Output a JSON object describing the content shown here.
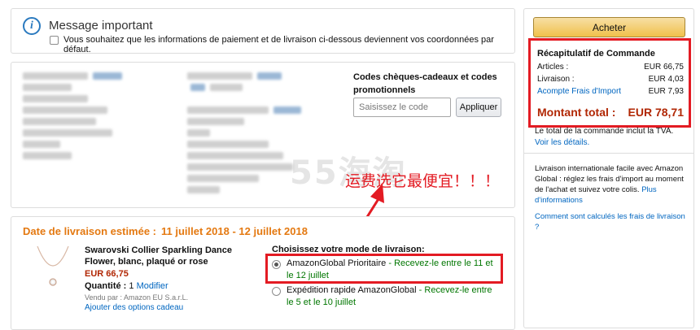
{
  "message": {
    "icon": "info-icon",
    "title": "Message important",
    "checkbox_label": "Vous souhaitez que les informations de paiement et de livraison ci-dessous deviennent vos coordonnées par défaut."
  },
  "codes": {
    "title": "Codes chèques-cadeaux et codes promotionnels",
    "placeholder": "Saisissez le code",
    "apply_label": "Appliquer"
  },
  "watermark": "55海淘",
  "annotation": "运费选它最便宜！！！",
  "delivery": {
    "label": "Date de livraison estimée :",
    "dates": "11 juillet 2018 - 12 juillet 2018",
    "product": {
      "name": "Swarovski Collier Sparkling Dance Flower, blanc, plaqué or rose",
      "price": "EUR 66,75",
      "quantity_label": "Quantité :",
      "quantity": "1",
      "modify_label": "Modifier",
      "seller": "Vendu par : Amazon EU S.a.r.L.",
      "gift_link": "Ajouter des options cadeau"
    },
    "shipping_title": "Choisissez votre mode de livraison:",
    "options": [
      {
        "name": "AmazonGlobal Prioritaire",
        "sep": " - ",
        "eta": "Recevez-le entre le 11 et le 12 juillet",
        "selected": true
      },
      {
        "name": "Expédition rapide AmazonGlobal",
        "sep": " - ",
        "eta": "Recevez-le entre le 5 et le 10 juillet",
        "selected": false
      }
    ]
  },
  "summary": {
    "buy_label": "Acheter",
    "title": "Récapitulatif de Commande",
    "rows": [
      {
        "label": "Articles :",
        "value": "EUR 66,75"
      },
      {
        "label": "Livraison :",
        "value": "EUR 4,03"
      },
      {
        "label": "Acompte Frais d'Import",
        "value": "EUR 7,93"
      }
    ],
    "total_label": "Montant total :",
    "total_value": "EUR 78,71",
    "tva_text": "Le total de la commande inclut la TVA.",
    "tva_link": "Voir les détails.",
    "intl_text": "Livraison internationale facile avec Amazon Global : réglez les frais d'import au moment de l'achat et suivez votre colis.",
    "intl_link": "Plus d'informations",
    "calc_link": "Comment sont calculés les frais de livraison ?"
  },
  "colors": {
    "accent": "#e47911",
    "price": "#b12704",
    "link": "#0066c0",
    "highlight": "#e31b23",
    "eta": "#007600"
  }
}
